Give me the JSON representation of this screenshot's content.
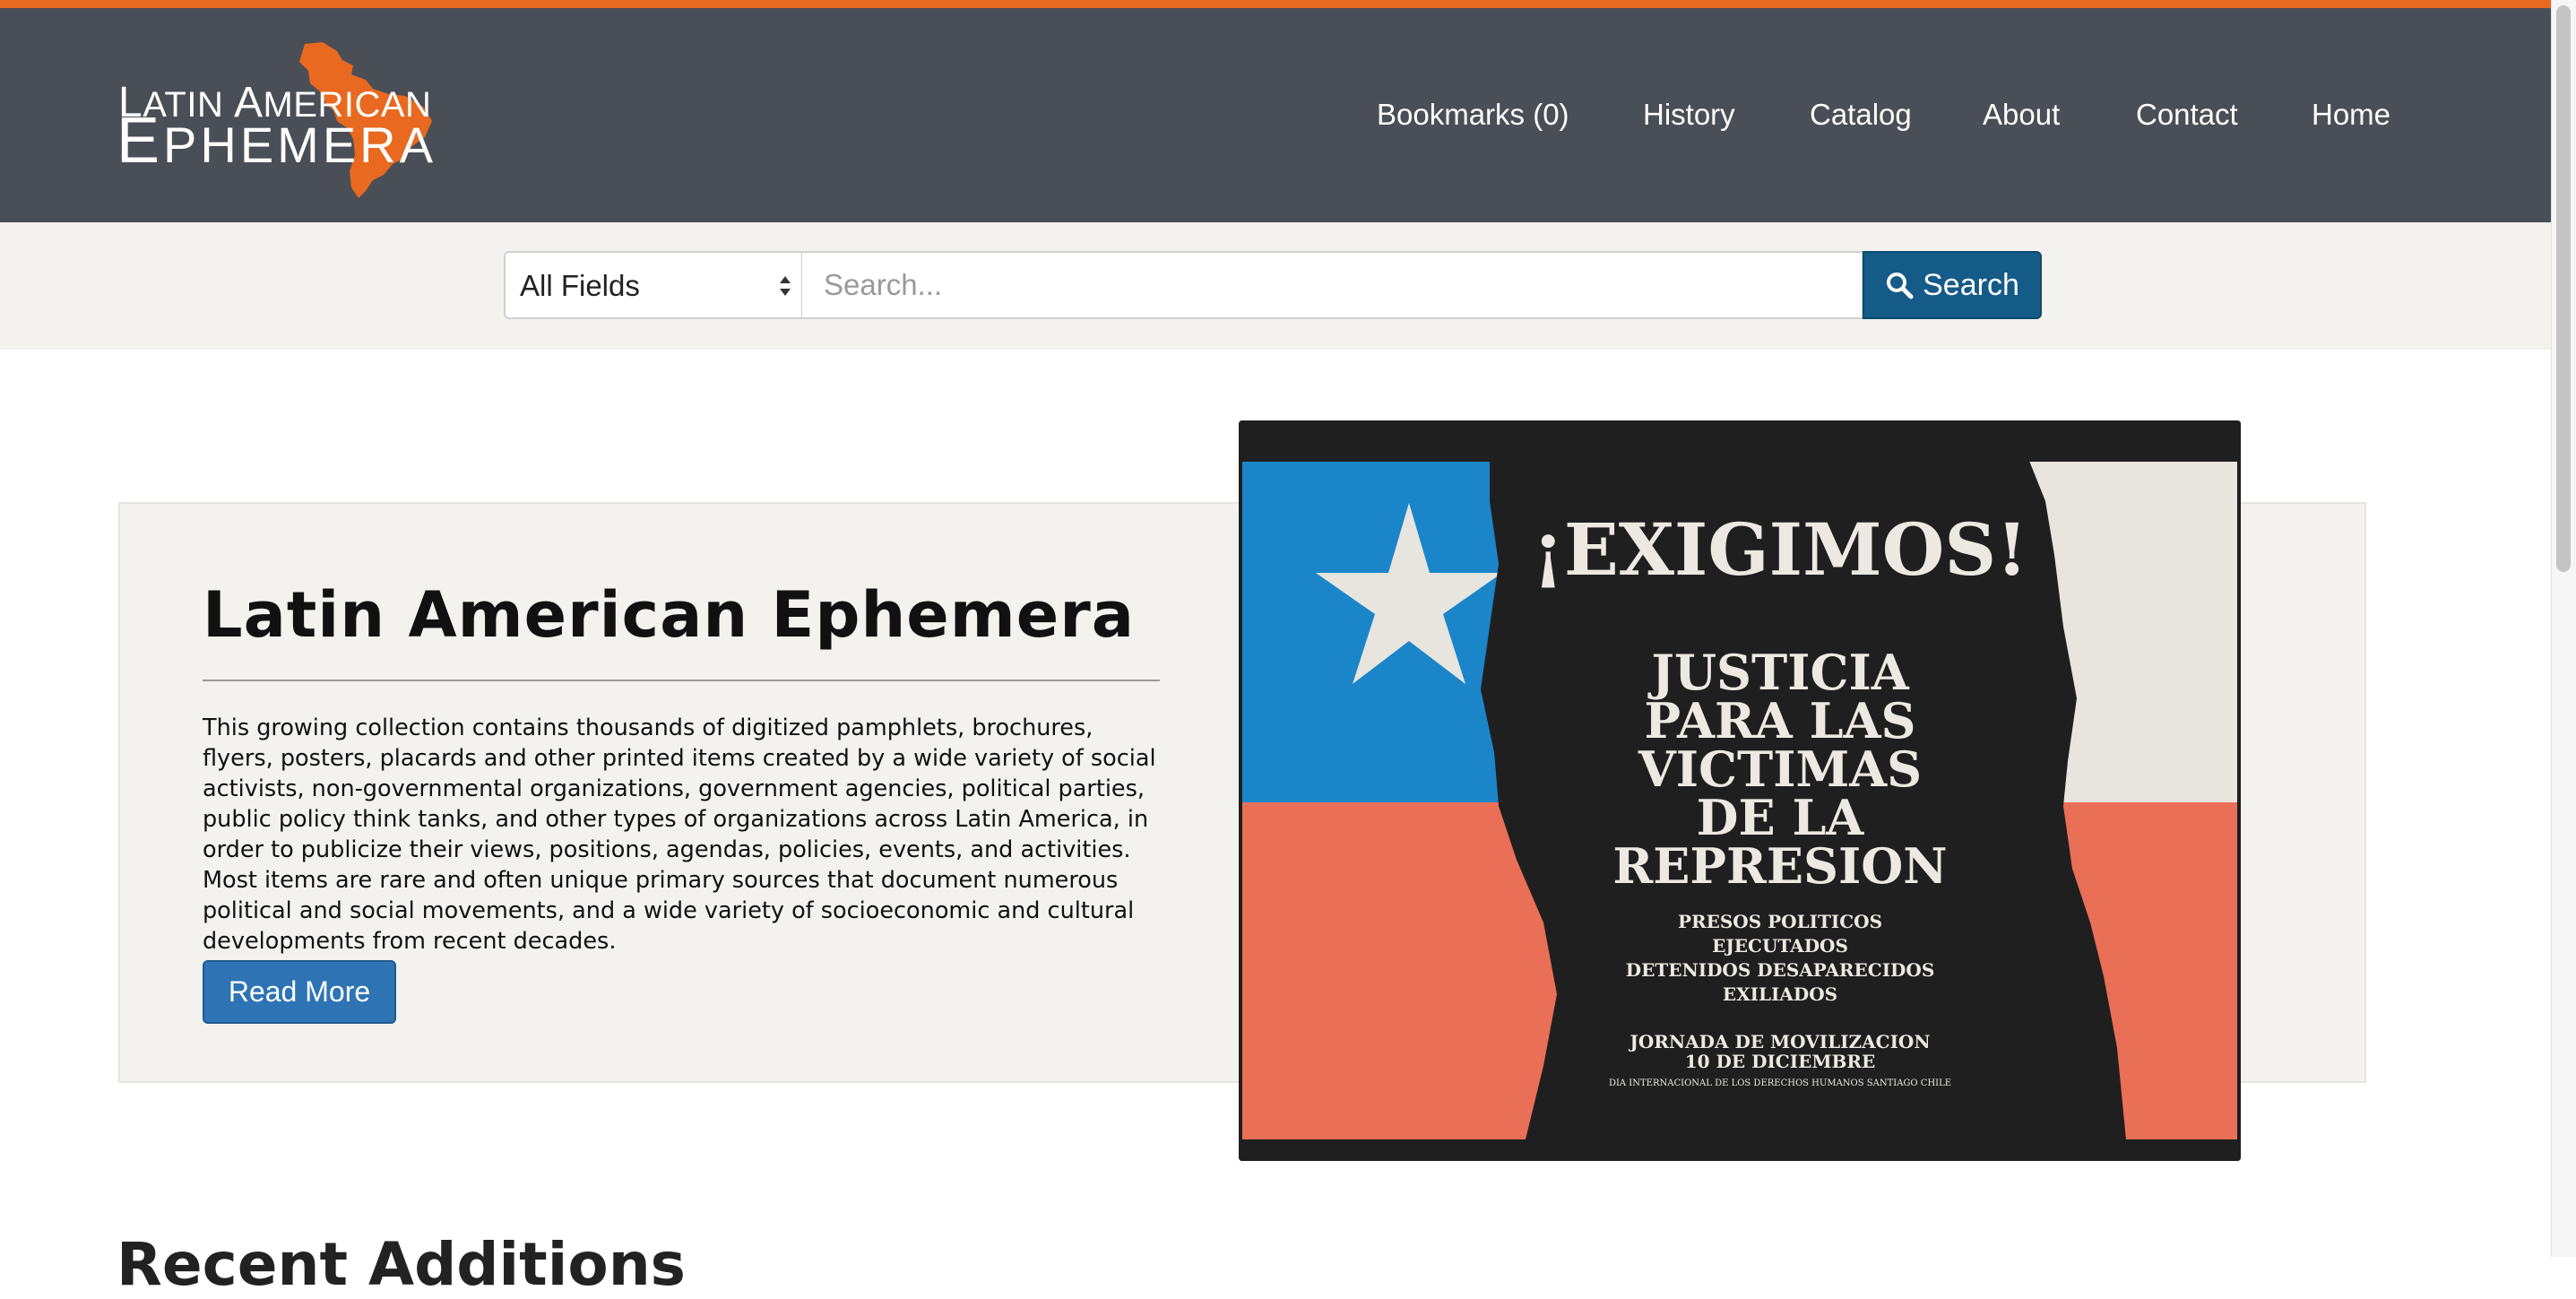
{
  "brand": {
    "logo_line1": "Latin American",
    "logo_line2": "Ephemera",
    "accent_color": "#e8691f",
    "navbar_color": "#4a4e56"
  },
  "nav": {
    "items": [
      {
        "label": "Bookmarks (0)"
      },
      {
        "label": "History"
      },
      {
        "label": "Catalog"
      },
      {
        "label": "About"
      },
      {
        "label": "Contact"
      },
      {
        "label": "Home"
      }
    ]
  },
  "search": {
    "field_selected": "All Fields",
    "placeholder": "Search...",
    "button_label": "Search",
    "button_color": "#155b88"
  },
  "hero": {
    "title": "Latin American Ephemera",
    "description": "This growing collection contains thousands of digitized pamphlets, brochures, flyers, posters, placards and other printed items created by a wide variety of social activists, non-governmental organizations, government agencies, political parties, public policy think tanks, and other types of organizations across Latin America, in order to publicize their views, positions, agendas, policies, events, and activities. Most items are rare and often unique primary sources that document numerous political and social movements, and a wide variety of socioeconomic and cultural developments from recent decades.",
    "read_more_label": "Read More"
  },
  "poster": {
    "headline": "¡EXIGIMOS!",
    "main_lines": [
      "JUSTICIA",
      "PARA LAS",
      "VICTIMAS",
      "DE LA",
      "REPRESION"
    ],
    "sub_lines": [
      "PRESOS POLITICOS",
      "EJECUTADOS",
      "DETENIDOS DESAPARECIDOS",
      "EXILIADOS"
    ],
    "event_lines": [
      "JORNADA DE MOVILIZACION",
      "10 DE DICIEMBRE"
    ],
    "footer": "DIA INTERNACIONAL DE LOS DERECHOS HUMANOS SANTIAGO CHILE"
  },
  "recent": {
    "heading": "Recent Additions"
  }
}
